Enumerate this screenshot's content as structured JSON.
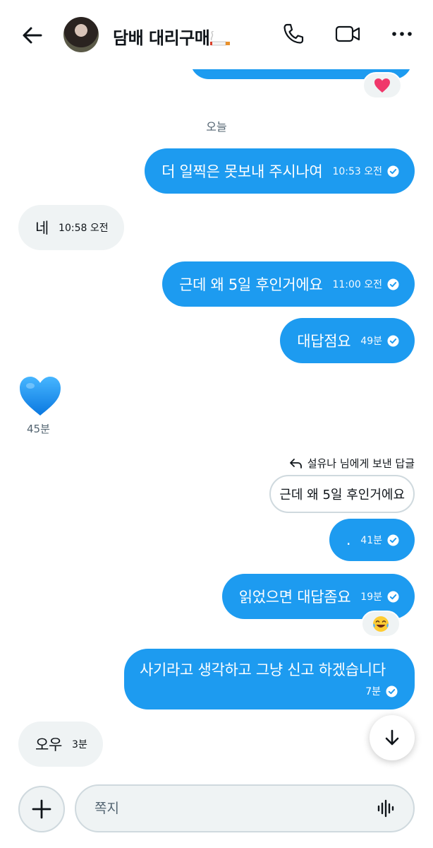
{
  "header": {
    "title": "담배 대리구매",
    "icons": [
      "back-arrow-icon",
      "avatar",
      "cigarette-emoji",
      "phone-icon",
      "video-camera-icon",
      "more-icon"
    ]
  },
  "day_label": "오늘",
  "messages": [
    {
      "id": "m1",
      "direction": "out",
      "text": "더 일찍은 못보내 주시나여",
      "time": "10:53 오전",
      "status": "read"
    },
    {
      "id": "m2",
      "direction": "in",
      "text": "네",
      "time": "10:58 오전"
    },
    {
      "id": "m3",
      "direction": "out",
      "text": "근데 왜 5일 후인거에요",
      "time": "11:00 오전",
      "status": "read"
    },
    {
      "id": "m4",
      "direction": "out",
      "text": "대답점요",
      "time": "49분",
      "status": "read"
    },
    {
      "id": "m5",
      "direction": "in",
      "type": "emoji",
      "emoji": "💙",
      "time": "45분"
    },
    {
      "id": "m6",
      "direction": "out",
      "reply_label": "설유나 님에게 보낸 답글",
      "quoted_text": "근데 왜 5일 후인거에요",
      "text": ".",
      "time": "41분",
      "status": "read"
    },
    {
      "id": "m7",
      "direction": "out",
      "text": "읽었으면 대답좀요",
      "time": "19분",
      "status": "read",
      "reaction": "😂"
    },
    {
      "id": "m8",
      "direction": "out",
      "text": "사기라고 생각하고 그냥 신고 하겠습니다",
      "time": "7분",
      "status": "read"
    },
    {
      "id": "m9",
      "direction": "in",
      "text": "오우",
      "time": "3분"
    }
  ],
  "top_reaction": "❤️",
  "composer": {
    "placeholder": "쪽지",
    "value": ""
  },
  "colors": {
    "accent": "#1d9bf0",
    "incoming_bubble": "#eff3f4",
    "secondary_text": "#536471"
  }
}
